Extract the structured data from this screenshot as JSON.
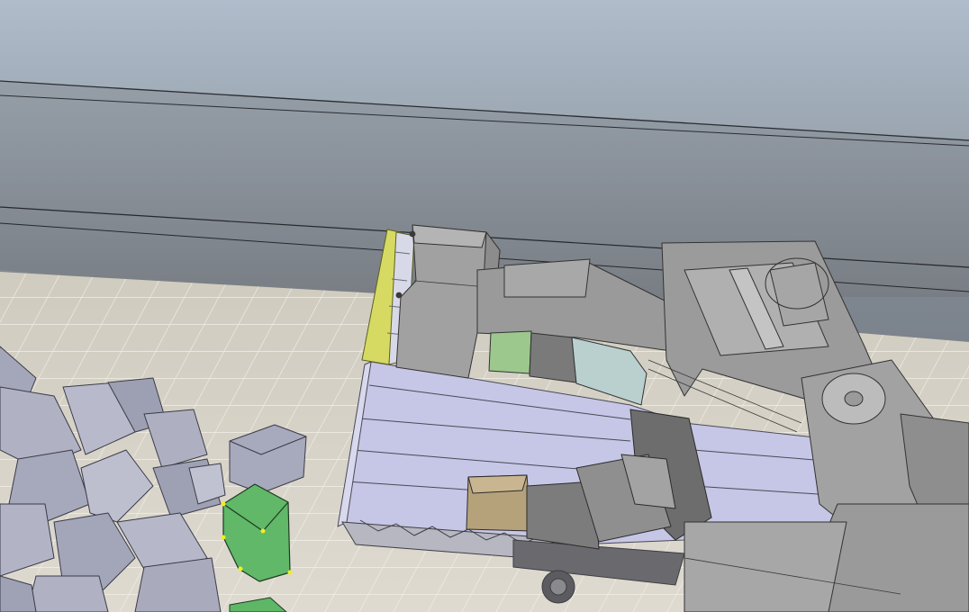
{
  "viewport": {
    "kind": "3D simulation viewport"
  },
  "colors": {
    "sky_top": "#adbac8",
    "sky_bottom": "#8f99a4",
    "wall": "#7d838a",
    "floor_light": "#d9d5cb",
    "floor_dark": "#c9c5bb",
    "box_gray": "#a9abbd",
    "box_selected": "#5db766",
    "selection_handle": "#f1ee22",
    "machine_gray": "#9b9b9b",
    "conveyor_lavender": "#c6c6e6",
    "scraper_yellow": "#d6da63",
    "hopper_tan": "#b6a27a",
    "cab_glass": "#b9d0cf"
  },
  "scene_objects": [
    {
      "name": "sky",
      "type": "background"
    },
    {
      "name": "wall",
      "type": "background"
    },
    {
      "name": "floor",
      "type": "tiled-ground"
    },
    {
      "name": "box-pile",
      "type": "objects"
    },
    {
      "name": "selected-box",
      "type": "object",
      "selected": true
    },
    {
      "name": "machine",
      "type": "industrial-machine"
    }
  ]
}
